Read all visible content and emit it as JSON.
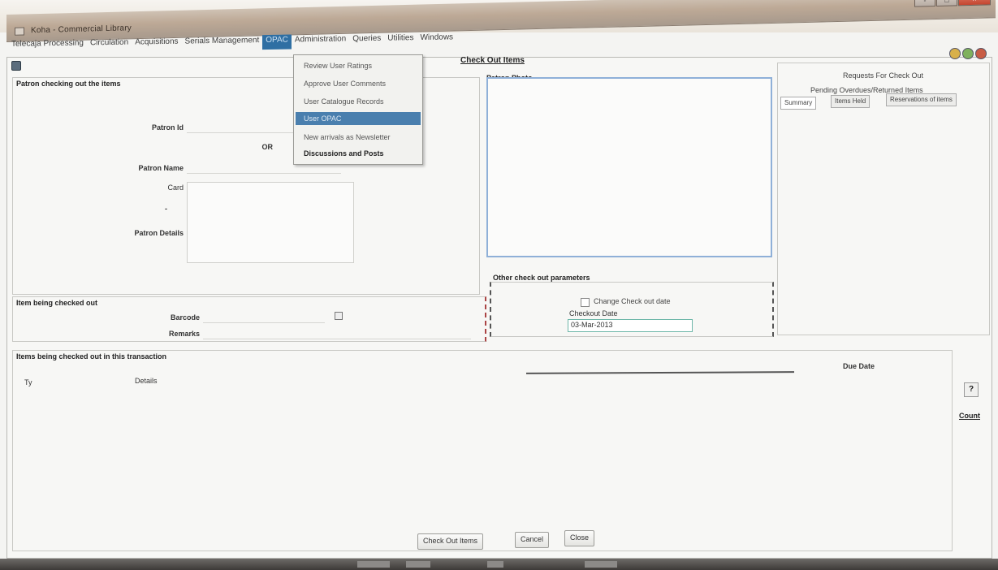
{
  "window": {
    "title": "Koha - Commercial Library",
    "controls": [
      "-",
      "□",
      "×"
    ]
  },
  "menubar": {
    "items": [
      {
        "label": "Telecaja Processing",
        "active": false
      },
      {
        "label": "Circulation",
        "active": false
      },
      {
        "label": "Acquisitions",
        "active": false
      },
      {
        "label": "Serials Management",
        "active": false
      },
      {
        "label": "OPAC",
        "active": true
      },
      {
        "label": "Administration",
        "active": false
      },
      {
        "label": "Queries",
        "active": false
      },
      {
        "label": "Utilities",
        "active": false
      },
      {
        "label": "Windows",
        "active": false
      }
    ]
  },
  "dropdown": {
    "items": [
      {
        "label": "Review User Ratings",
        "style": "normal"
      },
      {
        "label": "Approve User Comments",
        "style": "normal"
      },
      {
        "label": "User Catalogue Records",
        "style": "normal"
      },
      {
        "label": "User OPAC",
        "style": "selected"
      },
      {
        "label": "New arrivals as Newsletter",
        "style": "normal"
      },
      {
        "label": "Discussions and Posts",
        "style": "bold"
      }
    ]
  },
  "form": {
    "title": "Check Out Items",
    "patron_section": {
      "title": "Patron checking out the items",
      "patron_id_label": "Patron Id",
      "or_label": "OR",
      "patron_name_label": "Patron Name",
      "card_label": "Card",
      "dash_label": "-",
      "patron_details_label": "Patron Details"
    },
    "photo_section": {
      "title": "Patron Photo"
    },
    "other_params": {
      "title": "Other check out parameters",
      "change_date_label": "Change Check out date",
      "checkout_date_label": "Checkout Date",
      "checkout_date_value": "03-Mar-2013"
    },
    "right_panel": {
      "requests_label": "Requests For Check Out",
      "pending_label": "Pending Overdues/Returned Items",
      "tabs": [
        "Summary",
        "Items Held",
        "Reservations of items"
      ]
    },
    "item_section": {
      "title": "Item being checked out",
      "barcode_label": "Barcode",
      "remarks_label": "Remarks"
    },
    "items_table": {
      "title": "Items being checked out in this transaction",
      "columns": [
        "Ty",
        "Details",
        "Due Date"
      ],
      "rows": []
    },
    "side_count": {
      "icon": "?",
      "label": "Count"
    },
    "buttons": {
      "checkout": "Check Out Items",
      "cancel": "Cancel",
      "close": "Close"
    }
  }
}
